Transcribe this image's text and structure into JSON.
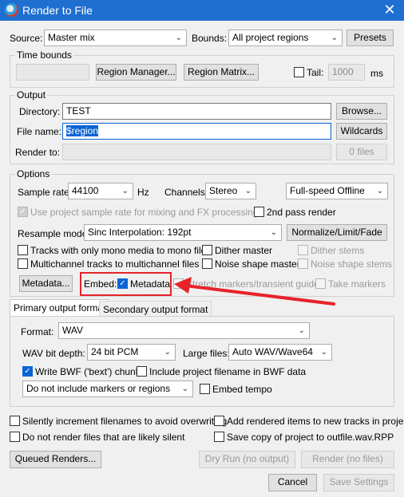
{
  "window": {
    "title": "Render to File",
    "close_glyph": "✕"
  },
  "source": {
    "label": "Source:",
    "value": "Master mix"
  },
  "bounds": {
    "label": "Bounds:",
    "value": "All project regions"
  },
  "presets_label": "Presets",
  "time_bounds": {
    "title": "Time bounds",
    "region_manager": "Region Manager...",
    "region_matrix": "Region Matrix...",
    "tail_label": "Tail:",
    "tail_value": "1000",
    "tail_unit": "ms"
  },
  "output": {
    "title": "Output",
    "directory_label": "Directory:",
    "directory_value": "TEST",
    "browse_label": "Browse...",
    "filename_label": "File name:",
    "filename_value": "$region",
    "wildcards_label": "Wildcards",
    "render_to_label": "Render to:",
    "files_count": "0 files"
  },
  "options": {
    "title": "Options",
    "sample_rate_label": "Sample rate:",
    "sample_rate_value": "44100",
    "hz": "Hz",
    "channels_label": "Channels:",
    "channels_value": "Stereo",
    "speed_value": "Full-speed Offline",
    "use_project_rate": "Use project sample rate for mixing and FX processing",
    "second_pass": "2nd pass render",
    "resample_label": "Resample mode:",
    "resample_value": "Sinc Interpolation: 192pt",
    "normalize_label": "Normalize/Limit/Fade",
    "mono_tracks": "Tracks with only mono media to mono file",
    "dither_master": "Dither master",
    "dither_stems": "Dither stems",
    "multichannel": "Multichannel tracks to multichannel files",
    "noise_master": "Noise shape master",
    "noise_stems": "Noise shape stems",
    "metadata_button": "Metadata...",
    "embed_label": "Embed:",
    "embed_metadata": "Metadata",
    "stretch_markers": "Stretch markers/transient guides",
    "take_markers": "Take markers"
  },
  "tabs": [
    "Primary output format",
    "Secondary output format"
  ],
  "format": {
    "format_label": "Format:",
    "format_value": "WAV",
    "bitdepth_label": "WAV bit depth:",
    "bitdepth_value": "24 bit PCM",
    "large_files_label": "Large files:",
    "large_files_value": "Auto WAV/Wave64",
    "bwf_chunk": "Write BWF ('bext') chunk",
    "include_filename": "Include project filename in BWF data",
    "markers_value": "Do not include markers or regions",
    "embed_tempo": "Embed tempo"
  },
  "bottom": {
    "silently_increment": "Silently increment filenames to avoid overwriting",
    "add_rendered": "Add rendered items to new tracks in project",
    "do_not_render": "Do not render files that are likely silent",
    "save_copy": "Save copy of project to outfile.wav.RPP",
    "queued_renders": "Queued Renders...",
    "dry_run": "Dry Run (no output)",
    "render": "Render (no files)",
    "cancel": "Cancel",
    "save_settings": "Save Settings"
  },
  "colors": {
    "title_bar": "#1f6fd1",
    "accent": "#0a64d6",
    "annotation": "#e8232a"
  },
  "icons": [
    "reaper-app-icon",
    "close-icon",
    "chevron-down-icon",
    "checkmark-icon",
    "annotation-arrow"
  ]
}
